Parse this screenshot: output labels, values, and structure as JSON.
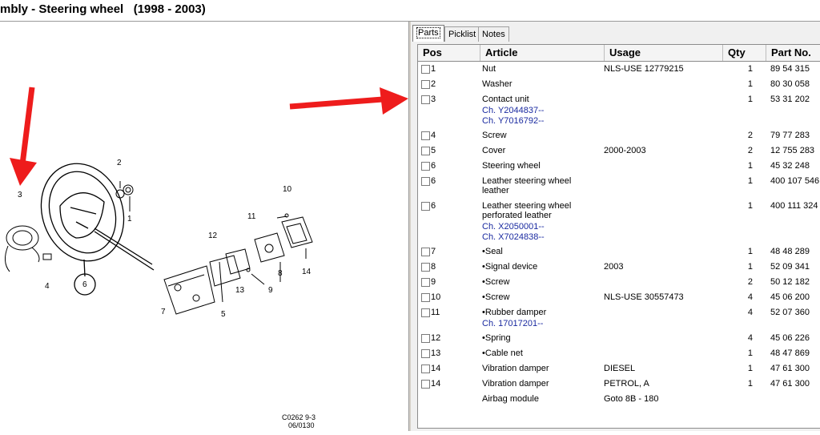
{
  "window": {
    "title": "mbly - Steering wheel   (1998 - 2003)"
  },
  "tabs": [
    {
      "label": "Parts",
      "active": true
    },
    {
      "label": "Picklist",
      "active": false
    },
    {
      "label": "Notes",
      "active": false
    }
  ],
  "table": {
    "headers": {
      "pos": "Pos",
      "article": "Article",
      "usage": "Usage",
      "qty": "Qty",
      "partno": "Part No."
    },
    "rows": [
      {
        "pos": "1",
        "article": "Nut",
        "usage": "NLS-USE 12779215",
        "qty": "1",
        "partno": "89 54 315"
      },
      {
        "pos": "2",
        "article": "Washer",
        "usage": "",
        "qty": "1",
        "partno": "80 30 058"
      },
      {
        "pos": "3",
        "article": "Contact unit",
        "article2": "",
        "chassis1": "Ch. Y2044837--",
        "chassis2": "Ch. Y7016792--",
        "usage": "",
        "qty": "1",
        "partno": "53 31 202"
      },
      {
        "pos": "4",
        "article": "Screw",
        "usage": "",
        "qty": "2",
        "partno": "79 77 283"
      },
      {
        "pos": "5",
        "article": "Cover",
        "usage": "2000-2003",
        "qty": "2",
        "partno": "12 755 283"
      },
      {
        "pos": "6",
        "article": "Steering wheel",
        "usage": "",
        "qty": "1",
        "partno": "45 32 248"
      },
      {
        "pos": "6",
        "article": "Leather steering wheel",
        "article2": "leather",
        "usage": "",
        "qty": "1",
        "partno": "400 107 546"
      },
      {
        "pos": "6",
        "article": "Leather steering wheel",
        "article2": "perforated leather",
        "chassis1": "Ch. X2050001--",
        "chassis2": "Ch. X7024838--",
        "usage": "",
        "qty": "1",
        "partno": "400 111 324"
      },
      {
        "pos": "7",
        "article": "•Seal",
        "usage": "",
        "qty": "1",
        "partno": "48 48 289"
      },
      {
        "pos": "8",
        "article": "•Signal device",
        "usage": "2003",
        "qty": "1",
        "partno": "52 09 341"
      },
      {
        "pos": "9",
        "article": "•Screw",
        "usage": "",
        "qty": "2",
        "partno": "50 12 182"
      },
      {
        "pos": "10",
        "article": "•Screw",
        "usage": "NLS-USE 30557473",
        "qty": "4",
        "partno": "45 06 200"
      },
      {
        "pos": "11",
        "article": "•Rubber damper",
        "chassis1": "Ch. 17017201--",
        "usage": "",
        "qty": "4",
        "partno": "52 07 360"
      },
      {
        "pos": "12",
        "article": "•Spring",
        "usage": "",
        "qty": "4",
        "partno": "45 06 226"
      },
      {
        "pos": "13",
        "article": "•Cable net",
        "usage": "",
        "qty": "1",
        "partno": "48 47 869"
      },
      {
        "pos": "14",
        "article": "Vibration damper",
        "usage": "DIESEL",
        "qty": "1",
        "partno": "47 61 300"
      },
      {
        "pos": "14",
        "article": "Vibration damper",
        "usage": "PETROL, A",
        "qty": "1",
        "partno": "47 61 300"
      },
      {
        "pos": "",
        "article": "Airbag module",
        "usage": "Goto 8B - 180",
        "qty": "",
        "partno": "",
        "nocheckbox": true
      }
    ]
  },
  "diagram": {
    "callouts": [
      "1",
      "2",
      "3",
      "4",
      "5",
      "6",
      "7",
      "8",
      "9",
      "10",
      "11",
      "12",
      "13",
      "14"
    ],
    "code_line1": "C0262 9-3",
    "code_line2": "06/0130"
  },
  "colors": {
    "arrow": "#ee1c1c",
    "chassis_text": "#1a2aa0"
  }
}
